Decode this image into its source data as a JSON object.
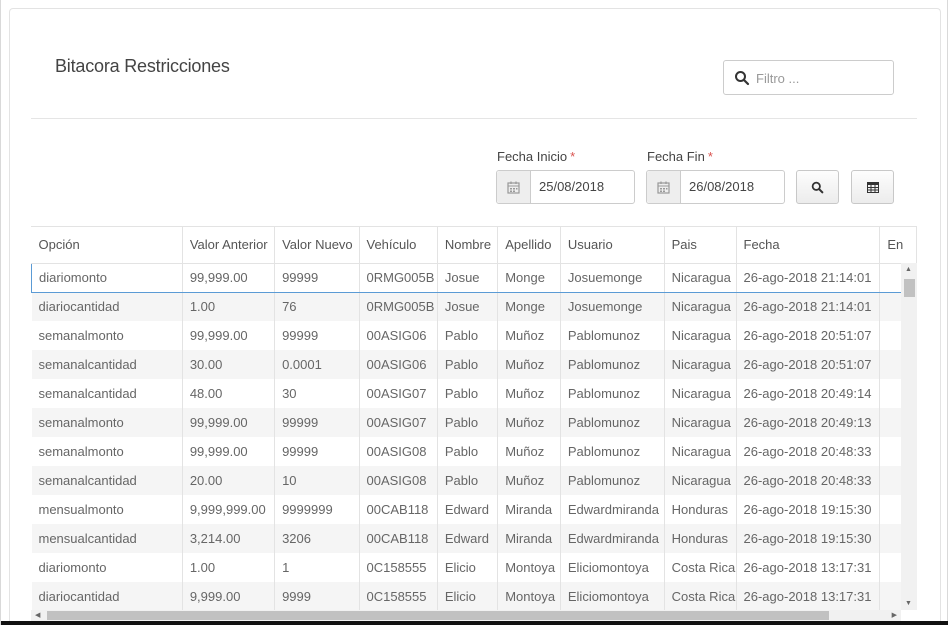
{
  "page": {
    "title": "Bitacora Restricciones"
  },
  "filter": {
    "placeholder": "Filtro ..."
  },
  "dates": {
    "start_label": "Fecha Inicio",
    "start_value": "25/08/2018",
    "end_label": "Fecha Fin",
    "end_value": "26/08/2018",
    "required_mark": "*"
  },
  "icons": {
    "search": "search-icon",
    "calendar": "calendar-icon",
    "table": "table-icon"
  },
  "table": {
    "headers": [
      "Opción",
      "Valor Anterior",
      "Valor Nuevo",
      "Vehículo",
      "Nombre",
      "Apellido",
      "Usuario",
      "Pais",
      "Fecha",
      "En"
    ],
    "rows": [
      [
        "diariomonto",
        "99,999.00",
        "99999",
        "0RMG005B",
        "Josue",
        "Monge",
        "Josuemonge",
        "Nicaragua",
        "26-ago-2018 21:14:01",
        ""
      ],
      [
        "diariocantidad",
        "1.00",
        "76",
        "0RMG005B",
        "Josue",
        "Monge",
        "Josuemonge",
        "Nicaragua",
        "26-ago-2018 21:14:01",
        ""
      ],
      [
        "semanalmonto",
        "99,999.00",
        "99999",
        "00ASIG06",
        "Pablo",
        "Muñoz",
        "Pablomunoz",
        "Nicaragua",
        "26-ago-2018 20:51:07",
        ""
      ],
      [
        "semanalcantidad",
        "30.00",
        "0.0001",
        "00ASIG06",
        "Pablo",
        "Muñoz",
        "Pablomunoz",
        "Nicaragua",
        "26-ago-2018 20:51:07",
        ""
      ],
      [
        "semanalcantidad",
        "48.00",
        "30",
        "00ASIG07",
        "Pablo",
        "Muñoz",
        "Pablomunoz",
        "Nicaragua",
        "26-ago-2018 20:49:14",
        ""
      ],
      [
        "semanalmonto",
        "99,999.00",
        "99999",
        "00ASIG07",
        "Pablo",
        "Muñoz",
        "Pablomunoz",
        "Nicaragua",
        "26-ago-2018 20:49:13",
        ""
      ],
      [
        "semanalmonto",
        "99,999.00",
        "99999",
        "00ASIG08",
        "Pablo",
        "Muñoz",
        "Pablomunoz",
        "Nicaragua",
        "26-ago-2018 20:48:33",
        ""
      ],
      [
        "semanalcantidad",
        "20.00",
        "10",
        "00ASIG08",
        "Pablo",
        "Muñoz",
        "Pablomunoz",
        "Nicaragua",
        "26-ago-2018 20:48:33",
        ""
      ],
      [
        "mensualmonto",
        "9,999,999.00",
        "9999999",
        "00CAB118",
        "Edward",
        "Miranda",
        "Edwardmiranda",
        "Honduras",
        "26-ago-2018 19:15:30",
        ""
      ],
      [
        "mensualcantidad",
        "3,214.00",
        "3206",
        "00CAB118",
        "Edward",
        "Miranda",
        "Edwardmiranda",
        "Honduras",
        "26-ago-2018 19:15:30",
        ""
      ],
      [
        "diariomonto",
        "1.00",
        "1",
        "0C158555",
        "Elicio",
        "Montoya",
        "Eliciomontoya",
        "Costa Rica",
        "26-ago-2018 13:17:31",
        ""
      ],
      [
        "diariocantidad",
        "9,999.00",
        "9999",
        "0C158555",
        "Elicio",
        "Montoya",
        "Eliciomontoya",
        "Costa Rica",
        "26-ago-2018 13:17:31",
        ""
      ]
    ]
  }
}
